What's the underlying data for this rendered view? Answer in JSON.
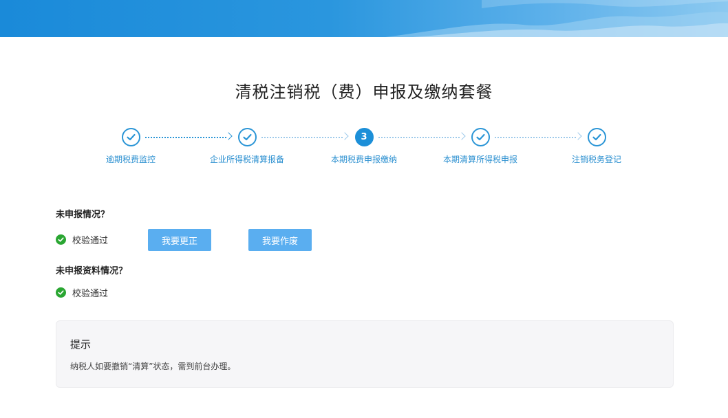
{
  "page": {
    "title": "清税注销税（费）申报及缴纳套餐"
  },
  "steps": [
    {
      "label": "逾期税费监控",
      "state": "done"
    },
    {
      "label": "企业所得税清算报备",
      "state": "done"
    },
    {
      "label": "本期税费申报缴纳",
      "state": "current",
      "number": "3"
    },
    {
      "label": "本期清算所得税申报",
      "state": "done"
    },
    {
      "label": "注销税务登记",
      "state": "done"
    }
  ],
  "unfiled": {
    "title": "未申报情况？",
    "status": "校验通过",
    "correct_button": "我要更正",
    "void_button": "我要作废"
  },
  "unfiled_materials": {
    "title": "未申报资料情况？",
    "status": "校验通过"
  },
  "tip": {
    "title": "提示",
    "text": "纳税人如要撤销“清算”状态，需到前台办理。"
  },
  "colors": {
    "accent": "#1c8fd8",
    "button": "#5aaef0",
    "success": "#2aa632"
  }
}
